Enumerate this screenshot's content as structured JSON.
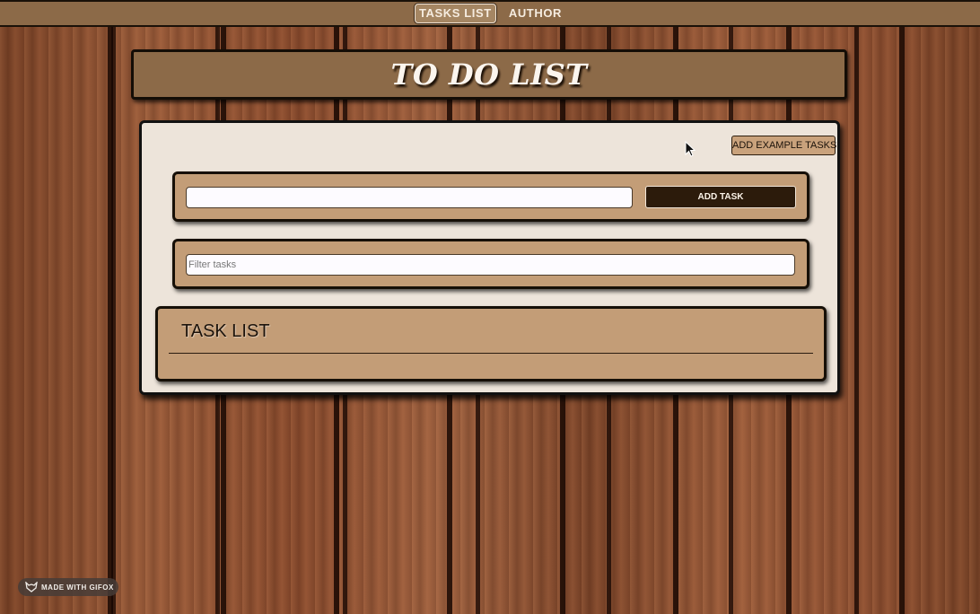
{
  "nav": {
    "items": [
      {
        "label": "TASKS LIST",
        "active": true
      },
      {
        "label": "AUTHOR",
        "active": false
      }
    ]
  },
  "header": {
    "title": "TO DO LIST"
  },
  "card": {
    "example_button_label": "ADD EXAMPLE TASKS",
    "add_task": {
      "input_value": "",
      "button_label": "ADD TASK"
    },
    "filter": {
      "placeholder": "Filter tasks",
      "value": ""
    },
    "task_list": {
      "title": "TASK LIST",
      "items": []
    }
  },
  "watermark": {
    "label": "MADE WITH GIFOX",
    "icon": "fox-icon"
  },
  "colors": {
    "nav_bg": "#8c6a48",
    "panel_bg": "#c39d77",
    "card_bg": "#ede4da",
    "button_dark": "#2c1b0b"
  }
}
